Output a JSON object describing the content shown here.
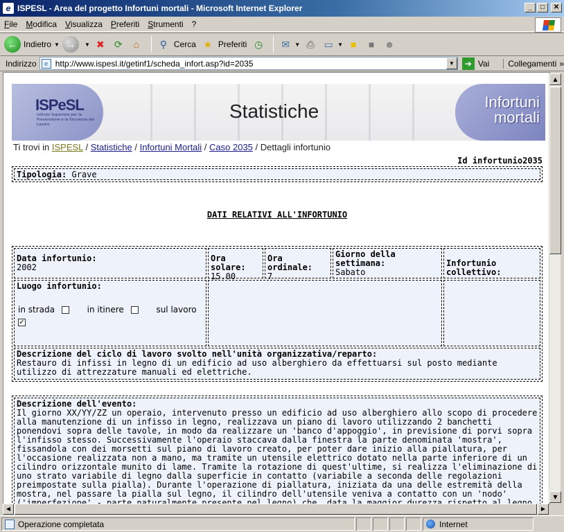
{
  "window": {
    "title": "ISPESL - Area del progetto Infortuni mortali - Microsoft Internet Explorer",
    "controls": {
      "minimize": "_",
      "maximize": "□",
      "close": "✕"
    }
  },
  "menu": [
    "File",
    "Modifica",
    "Visualizza",
    "Preferiti",
    "Strumenti",
    "?"
  ],
  "toolbar": {
    "back_label": "Indietro",
    "search_label": "Cerca",
    "favorites_label": "Preferiti"
  },
  "address": {
    "label": "Indirizzo",
    "url": "http://www.ispesl.it/getinf1/scheda_infort.asp?id=2035",
    "go_label": "Vai",
    "links_label": "Collegamenti"
  },
  "banner": {
    "logo_text": "ISPeSL",
    "logo_subtitle": "Istituto Superiore per la Prevenzione e la Sicurezza del Lavoro",
    "title": "Statistiche",
    "badge_line1": "Infortuni",
    "badge_line2": "mortali"
  },
  "breadcrumb": {
    "prefix": "Ti trovi in",
    "items": [
      "ISPESL",
      "Statistiche",
      "Infortuni Mortali",
      "Caso 2035"
    ],
    "current": "Dettagli infortunio"
  },
  "record": {
    "id_label": "Id infortunio",
    "id_value": "2035",
    "tipologia_label": "Tipologia:",
    "tipologia_value": "Grave"
  },
  "section": {
    "title": "DATI RELATIVI ALL'INFORTUNIO"
  },
  "fields": {
    "data_label": "Data infortunio:",
    "data_value": "2002",
    "ora_solare_label": "Ora solare:",
    "ora_solare_value": "15.00",
    "ora_ordinale_label": "Ora ordinale:",
    "ora_ordinale_value": "7",
    "giorno_label": "Giorno della settimana:",
    "giorno_value": "Sabato",
    "collettivo_label": "Infortunio collettivo:",
    "luogo_label": "Luogo infortunio:",
    "luogo_options": [
      {
        "label": "in strada",
        "checked": false
      },
      {
        "label": "in itinere",
        "checked": false
      },
      {
        "label": "sul lavoro",
        "checked": true
      }
    ],
    "ciclo_label": "Descrizione del ciclo di lavoro svolto nell'unità organizzativa/reparto:",
    "ciclo_value": "Restauro di infissi in legno di un edificio ad uso alberghiero da effettuarsi sul posto mediante utilizzo di attrezzature manuali ed elettriche.",
    "evento_label": "Descrizione dell'evento:",
    "evento_value": "Il giorno XX/YY/ZZ un operaio, intervenuto presso un edificio ad uso alberghiero allo scopo di procedere alla manutenzione di un infisso in legno, realizzava un piano di lavoro utilizzando 2 banchetti ponendovi sopra delle tavole, in modo da realizzare un 'banco d'appoggio', in previsione di porvi sopra l'infisso stesso. Successivamente l'operaio staccava dalla finestra la parte denominata 'mostra', fissandola con dei morsetti sul piano di lavoro creato, per poter dare inizio alla piallatura, per l'occasione realizzata non a mano, ma tramite un utensile elettrico dotato nella parte inferiore di un cilindro orizzontale munito di lame. Tramite la rotazione di quest'ultime, si realizza l'eliminazione di uno strato variabile di legno dalla superficie in contatto (variabile a seconda delle regolazioni preimpostate sulla pialla). Durante l'operazione di piallatura, iniziata da una delle estremità della mostra, nel passare la pialla sul legno, il cilindro dell'utensile veniva a contatto con un 'nodo' ('imperfezione' - parte naturalmente presente nel legno) che, data la maggior durezza rispetto al legno circostante, opponeva maggior resistenza al passaggio del cilindro facendo"
  },
  "status": {
    "text": "Operazione completata",
    "zone": "Internet"
  }
}
